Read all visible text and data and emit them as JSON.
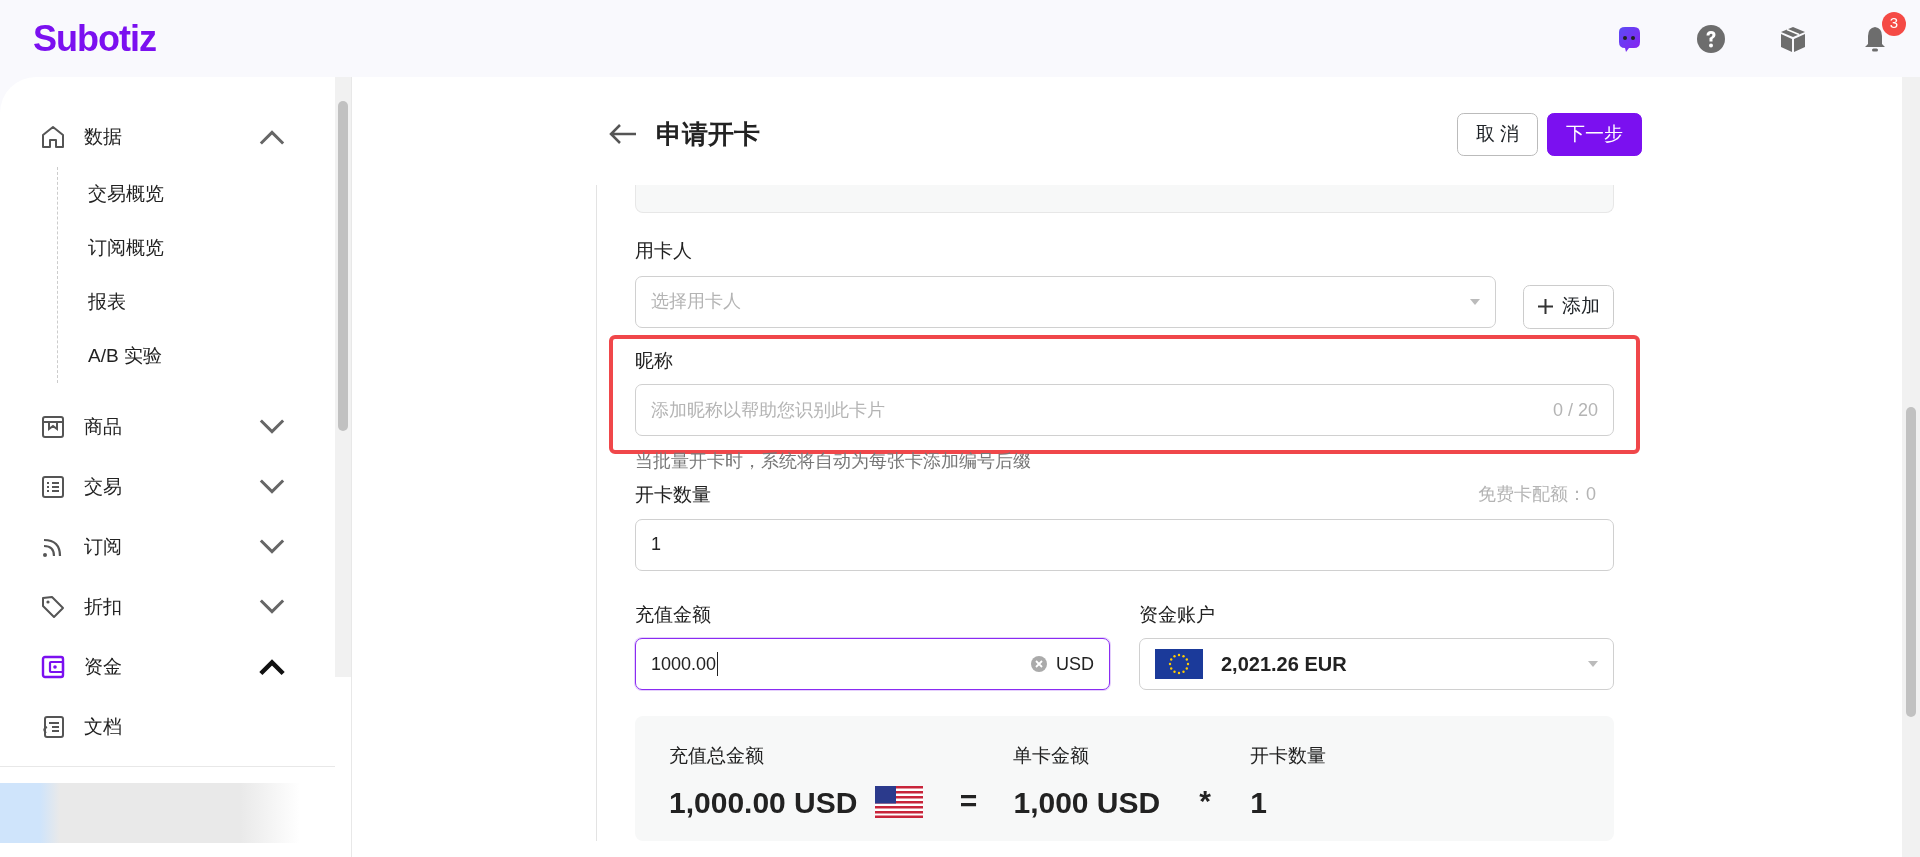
{
  "header": {
    "logo": "Subotiz",
    "notification_badge": "3"
  },
  "sidebar": {
    "items": [
      {
        "label": "数据",
        "expanded": true,
        "selected": false,
        "children": [
          {
            "label": "交易概览"
          },
          {
            "label": "订阅概览"
          },
          {
            "label": "报表"
          },
          {
            "label": "A/B 实验"
          }
        ]
      },
      {
        "label": "商品",
        "expanded": false,
        "selected": false
      },
      {
        "label": "交易",
        "expanded": false,
        "selected": false
      },
      {
        "label": "订阅",
        "expanded": false,
        "selected": false
      },
      {
        "label": "折扣",
        "expanded": false,
        "selected": false
      },
      {
        "label": "资金",
        "expanded": true,
        "selected": true
      },
      {
        "label": "文档"
      }
    ]
  },
  "page": {
    "title": "申请开卡",
    "buttons": [
      {
        "label": "取 消",
        "kind": "secondary"
      },
      {
        "label": "下一步",
        "kind": "primary"
      }
    ]
  },
  "form": {
    "cardholder": {
      "label": "用卡人",
      "placeholder": "选择用卡人",
      "add_button": "添加"
    },
    "nickname": {
      "label": "昵称",
      "placeholder": "添加昵称以帮助您识别此卡片",
      "counter": "0 / 20",
      "highlighted": true,
      "hint": "当批量开卡时，系统将自动为每张卡添加编号后缀"
    },
    "quantity": {
      "label": "开卡数量",
      "quota": "免费卡配额：0",
      "value": "1"
    },
    "amount": {
      "label": "充值金额",
      "value": "1000.00",
      "currency": "USD",
      "focused": true
    },
    "account": {
      "label": "资金账户",
      "value": "2,021.26 EUR"
    }
  },
  "summary": {
    "items": [
      {
        "label": "充值总金额",
        "value": "1,000.00 USD",
        "operator": "="
      },
      {
        "label": "单卡金额",
        "value": "1,000 USD",
        "operator": "*"
      },
      {
        "label": "开卡数量",
        "value": "1"
      }
    ]
  }
}
